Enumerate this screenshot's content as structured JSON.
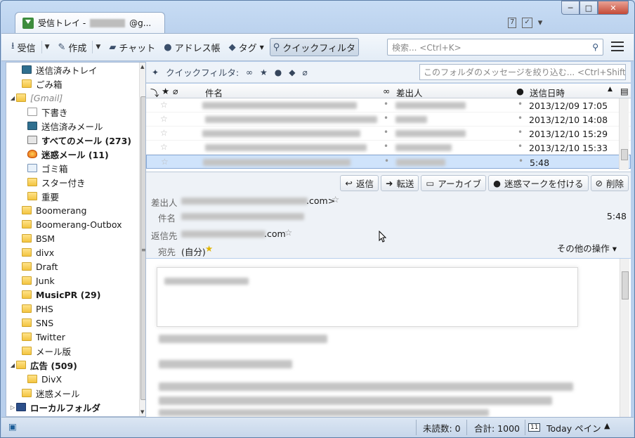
{
  "tab": {
    "title": "受信トレイ -",
    "suffix": "@g...",
    "close": "×"
  },
  "window_controls": {
    "min": "─",
    "max": "□",
    "close": "✕"
  },
  "title_icons": {
    "calendar": "7",
    "tasks": "✓",
    "drop": "▾"
  },
  "toolbar": {
    "receive": "受信",
    "compose": "作成",
    "chat": "チャット",
    "addressbook": "アドレス帳",
    "tag": "タグ",
    "quickfilter": "クイックフィルタ",
    "search_placeholder": "検索... <Ctrl+K>"
  },
  "folders": [
    {
      "label": "送信済みトレイ",
      "icon": "sent",
      "indent": 1,
      "bold": false
    },
    {
      "label": "ごみ箱",
      "icon": "folder",
      "indent": 1,
      "bold": false
    },
    {
      "label": "[Gmail]",
      "icon": "folder",
      "indent": 0,
      "twisty": "◢",
      "dim": true
    },
    {
      "label": "下書き",
      "icon": "draft",
      "indent": 2
    },
    {
      "label": "送信済みメール",
      "icon": "sent",
      "indent": 2
    },
    {
      "label": "すべてのメール (273)",
      "icon": "all",
      "indent": 2,
      "bold": true
    },
    {
      "label": "迷惑メール (11)",
      "icon": "spam",
      "indent": 2,
      "bold": true
    },
    {
      "label": "ゴミ箱",
      "icon": "trash",
      "indent": 2
    },
    {
      "label": "スター付き",
      "icon": "folder",
      "indent": 2
    },
    {
      "label": "重要",
      "icon": "folder",
      "indent": 2
    },
    {
      "label": "Boomerang",
      "icon": "folder",
      "indent": 1
    },
    {
      "label": "Boomerang-Outbox",
      "icon": "folder",
      "indent": 1
    },
    {
      "label": "BSM",
      "icon": "folder",
      "indent": 1
    },
    {
      "label": "divx",
      "icon": "folder",
      "indent": 1
    },
    {
      "label": "Draft",
      "icon": "folder",
      "indent": 1
    },
    {
      "label": "Junk",
      "icon": "folder",
      "indent": 1
    },
    {
      "label": "MusicPR (29)",
      "icon": "folder",
      "indent": 1,
      "bold": true
    },
    {
      "label": "PHS",
      "icon": "folder",
      "indent": 1
    },
    {
      "label": "SNS",
      "icon": "folder",
      "indent": 1
    },
    {
      "label": "Twitter",
      "icon": "folder",
      "indent": 1
    },
    {
      "label": "メール版",
      "icon": "folder",
      "indent": 1
    },
    {
      "label": "広告 (509)",
      "icon": "folder",
      "indent": 0,
      "twisty": "◢",
      "bold": true
    },
    {
      "label": "DivX",
      "icon": "folder",
      "indent": 2
    },
    {
      "label": "迷惑メール",
      "icon": "folder",
      "indent": 1
    },
    {
      "label": "ローカルフォルダ",
      "icon": "local",
      "indent": 0,
      "twisty": "▷",
      "bold": true
    }
  ],
  "quickfilter": {
    "label": "クイックフィルタ:",
    "placeholder": "このフォルダのメッセージを絞り込む... <Ctrl+Shift+K>"
  },
  "thread_columns": {
    "subject": "件名",
    "sender": "差出人",
    "date": "送信日時"
  },
  "threads": [
    {
      "date": "2013/12/09 17:05",
      "selected": false
    },
    {
      "date": "2013/12/10 14:08",
      "selected": false
    },
    {
      "date": "2013/12/10 15:29",
      "selected": false
    },
    {
      "date": "2013/12/10 15:33",
      "selected": false
    },
    {
      "date": "5:48",
      "selected": true
    }
  ],
  "message": {
    "actions": [
      "返信",
      "転送",
      "アーカイブ",
      "迷惑マークを付ける",
      "削除"
    ],
    "from_label": "差出人",
    "from_suffix": ".com>",
    "subject_label": "件名",
    "time": "5:48",
    "replyto_label": "返信先",
    "replyto_suffix": ".com",
    "to_label": "宛先",
    "to_value": "(自分)",
    "other_ops": "その他の操作 ▾"
  },
  "status": {
    "unread": "未読数: 0",
    "total": "合計: 1000",
    "today": "Today ペイン",
    "today_icon": "11"
  }
}
